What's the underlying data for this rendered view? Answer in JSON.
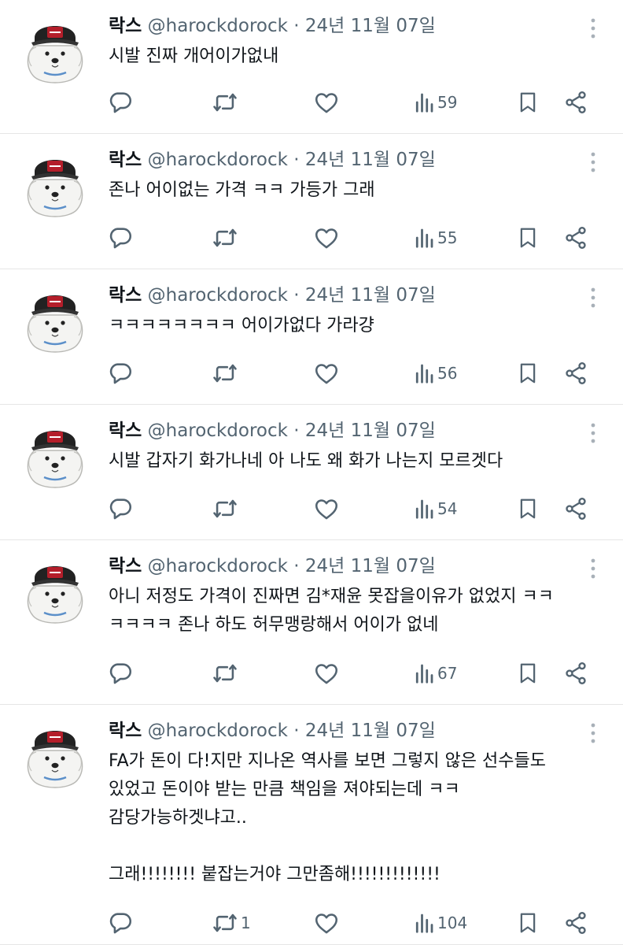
{
  "colors": {
    "text": "#0f1419",
    "secondary": "#536471",
    "divider": "#e6e6e6"
  },
  "tweets": [
    {
      "name": "락스",
      "handle": "@harockdorock",
      "dot": "·",
      "date": "24년 11월 07일",
      "text": "시발 진짜 개어이가없내",
      "reply": "",
      "retweet": "",
      "like": "",
      "views": "59"
    },
    {
      "name": "락스",
      "handle": "@harockdorock",
      "dot": "·",
      "date": "24년 11월 07일",
      "text": "존나 어이없는 가격 ㅋㅋ 가등가 그래",
      "reply": "",
      "retweet": "",
      "like": "",
      "views": "55"
    },
    {
      "name": "락스",
      "handle": "@harockdorock",
      "dot": "·",
      "date": "24년 11월 07일",
      "text": "ㅋㅋㅋㅋㅋㅋㅋㅋ 어이가없다 가라걍",
      "reply": "",
      "retweet": "",
      "like": "",
      "views": "56"
    },
    {
      "name": "락스",
      "handle": "@harockdorock",
      "dot": "·",
      "date": "24년 11월 07일",
      "text": "시발 갑자기 화가나네 아 나도 왜 화가 나는지 모르겟다",
      "reply": "",
      "retweet": "",
      "like": "",
      "views": "54"
    },
    {
      "name": "락스",
      "handle": "@harockdorock",
      "dot": "·",
      "date": "24년 11월 07일",
      "text": "아니 저정도 가격이 진짜면 김*재윤 못잡을이유가 없었지 ㅋㅋ\nㅋㅋㅋㅋ 존나 하도 허무맹랑해서 어이가 없네",
      "reply": "",
      "retweet": "",
      "like": "",
      "views": "67"
    },
    {
      "name": "락스",
      "handle": "@harockdorock",
      "dot": "·",
      "date": "24년 11월 07일",
      "text": "FA가 돈이 다!지만 지나온 역사를 보면 그렇지 않은 선수들도\n있었고 돈이야 받는 만큼 책임을 져야되는데 ㅋㅋ\n감당가능하겟냐고..\n\n그래!!!!!!!! 붙잡는거야 그만좀해!!!!!!!!!!!!!",
      "reply": "",
      "retweet": "1",
      "like": "",
      "views": "104"
    }
  ]
}
